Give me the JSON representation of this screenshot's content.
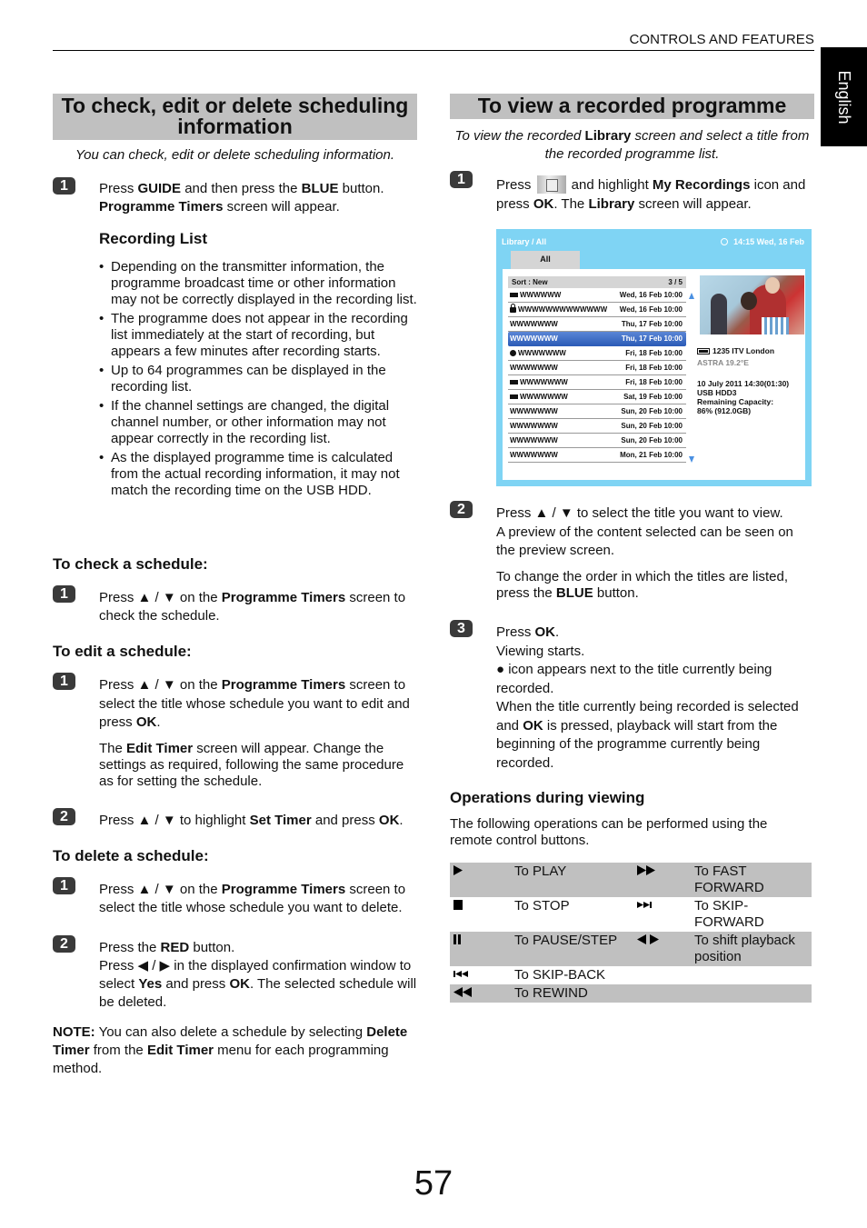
{
  "header": {
    "running_head": "CONTROLS AND FEATURES",
    "language_tab": "English"
  },
  "left": {
    "title": "To check, edit or delete scheduling information",
    "intro": "You can check, edit or delete scheduling information.",
    "step1": {
      "num": "1",
      "t1": "Press ",
      "b1": "GUIDE",
      "t2": " and then press the ",
      "b2": "BLUE",
      "t3": " button.",
      "b3": "Programme Timers",
      "t4": " screen will appear."
    },
    "recording_list": {
      "heading": "Recording List",
      "bullets": [
        "Depending on the transmitter information, the programme broadcast time or other information may not be correctly displayed in the recording list.",
        "The programme does not appear in the recording list immediately at the start of recording, but appears a few minutes after recording starts.",
        "Up to 64 programmes can be displayed in the recording list.",
        "If the channel settings are changed, the digital channel number, or other information may not appear correctly in the recording list.",
        "As the displayed programme time is calculated from the actual recording information, it may not match the recording time on the USB HDD."
      ]
    },
    "check": {
      "heading": "To check a schedule:",
      "step1": {
        "num": "1",
        "t1": "Press ▲ / ▼ on the ",
        "b1": "Programme Timers",
        "t2": " screen to check the schedule."
      }
    },
    "edit": {
      "heading": "To edit a schedule:",
      "step1": {
        "num": "1",
        "t1": "Press ▲ / ▼ on the ",
        "b1": "Programme Timers",
        "t2": " screen to select the title whose schedule you want to edit and press ",
        "b2": "OK",
        "t3": "."
      },
      "note": {
        "t1": "The ",
        "b1": "Edit Timer",
        "t2": " screen will appear. Change the settings as required, following the same procedure as for setting the schedule."
      },
      "step2": {
        "num": "2",
        "t1": "Press ▲ / ▼ to highlight ",
        "b1": "Set Timer",
        "t2": " and press ",
        "b2": "OK",
        "t3": "."
      }
    },
    "delete": {
      "heading": "To delete a schedule:",
      "step1": {
        "num": "1",
        "t1": "Press ▲ / ▼ on the ",
        "b1": "Programme Timers",
        "t2": " screen to select the title whose schedule you want to delete."
      },
      "step2": {
        "num": "2",
        "t1": "Press the ",
        "b1": "RED",
        "t2": " button.",
        "t3": "Press ◀ / ▶ in the displayed confirmation window to select ",
        "b2": "Yes",
        "t4": " and press ",
        "b3": "OK",
        "t5": ". The selected schedule will be deleted."
      }
    },
    "note": {
      "b1": "NOTE:",
      "t1": " You can also delete a schedule by selecting ",
      "b2": "Delete Timer",
      "t2": " from the ",
      "b3": "Edit Timer",
      "t3": " menu for each programming method."
    }
  },
  "right": {
    "title": "To view a recorded programme",
    "intro": {
      "t1": "To view the recorded ",
      "b1": "Library",
      "t2": " screen and select a title from the recorded programme list."
    },
    "step1": {
      "num": "1",
      "t1": "Press ",
      "icon": "my-recordings-button-icon",
      "t2": " and highlight ",
      "b1": "My Recordings",
      "t3": " icon and press ",
      "b2": "OK",
      "t4": ". The ",
      "b3": "Library",
      "t5": " screen will appear."
    },
    "library": {
      "breadcrumb": "Library / All",
      "clock": "14:15 Wed, 16 Feb",
      "tab": "All",
      "sort_label": "Sort : New",
      "page": "3 / 5",
      "rows": [
        {
          "icon": "rect",
          "title": "WWWWWW",
          "date": "Wed, 16 Feb 10:00",
          "selected": false
        },
        {
          "icon": "lock",
          "title": "WWWWWWWWWWWWW",
          "date": "Wed, 16 Feb 10:00",
          "selected": false
        },
        {
          "icon": "",
          "title": "WWWWWWW",
          "date": "Thu, 17 Feb 10:00",
          "selected": false
        },
        {
          "icon": "",
          "title": "WWWWWWW",
          "date": "Thu, 17 Feb 10:00",
          "selected": true
        },
        {
          "icon": "dot",
          "title": "WWWWWWW",
          "date": "Fri, 18 Feb 10:00",
          "selected": false
        },
        {
          "icon": "",
          "title": "WWWWWWW",
          "date": "Fri, 18 Feb 10:00",
          "selected": false
        },
        {
          "icon": "rect",
          "title": "WWWWWWW",
          "date": "Fri, 18 Feb 10:00",
          "selected": false
        },
        {
          "icon": "rect",
          "title": "WWWWWWW",
          "date": "Sat, 19 Feb 10:00",
          "selected": false
        },
        {
          "icon": "",
          "title": "WWWWWWW",
          "date": "Sun, 20 Feb 10:00",
          "selected": false
        },
        {
          "icon": "",
          "title": "WWWWWWW",
          "date": "Sun, 20 Feb 10:00",
          "selected": false
        },
        {
          "icon": "",
          "title": "WWWWWWW",
          "date": "Sun, 20 Feb 10:00",
          "selected": false
        },
        {
          "icon": "",
          "title": "WWWWWWW",
          "date": "Mon, 21 Feb 10:00",
          "selected": false
        }
      ],
      "channel": "1235 ITV London",
      "satellite": "ASTRA 19.2°E",
      "recorded": "10 July 2011  14:30(01:30)",
      "device": "USB HDD3",
      "capacity_label": "Remaining Capacity:",
      "capacity_value": "86% (912.0GB)"
    },
    "step2": {
      "num": "2",
      "line1": "Press ▲ / ▼ to select the title you want to view.",
      "line2": "A preview of the content selected can be seen on the preview screen.",
      "t1": "To change the order in which the titles are listed, press the ",
      "b1": "BLUE",
      "t2": " button."
    },
    "step3": {
      "num": "3",
      "t1": "Press ",
      "b1": "OK",
      "t2": ".",
      "line2": "Viewing starts.",
      "line3": "● icon appears next to the title currently being recorded.",
      "t3": "When the title currently being recorded is selected and ",
      "b2": "OK",
      "t4": " is pressed, playback will start from the beginning of the programme currently being recorded."
    },
    "operations": {
      "heading": "Operations during viewing",
      "intro": "The following operations can be performed using the remote control buttons.",
      "rows": [
        {
          "icon1": "play-icon",
          "label1": "To PLAY",
          "icon2": "fast-forward-icon",
          "label2": "To FAST FORWARD",
          "shaded": true
        },
        {
          "icon1": "stop-icon",
          "label1": "To STOP",
          "icon2": "skip-forward-icon",
          "label2": "To SKIP-FORWARD",
          "shaded": false
        },
        {
          "icon1": "pause-icon",
          "label1": "To PAUSE/STEP",
          "icon2": "left-right-icon",
          "label2": "To shift playback position",
          "shaded": true
        },
        {
          "icon1": "skip-back-icon",
          "label1": "To SKIP-BACK",
          "icon2": "",
          "label2": "",
          "shaded": false
        },
        {
          "icon1": "rewind-icon",
          "label1": "To REWIND",
          "icon2": "",
          "label2": "",
          "shaded": true
        }
      ]
    }
  },
  "footer": {
    "page_number": "57"
  }
}
